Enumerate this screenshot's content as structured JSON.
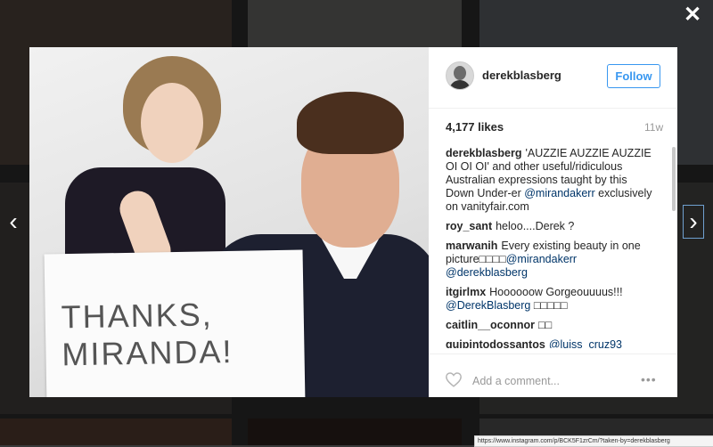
{
  "window": {
    "close_glyph": "✕",
    "prev_glyph": "‹",
    "next_glyph": "›",
    "status_url": "https://www.instagram.com/p/BCK5F1zrCm/?taken-by=derekblasberg"
  },
  "post": {
    "photo_sign_line1": "THANKS,",
    "photo_sign_line2": "MIRANDA!",
    "username": "derekblasberg",
    "follow_label": "Follow",
    "likes": "4,177 likes",
    "time_ago": "11w",
    "comments": [
      {
        "user": "derekblasberg",
        "text": "'AUZZIE AUZZIE AUZZIE OI OI OI' and other useful/ridiculous Australian expressions taught by this Down Under-er ",
        "mention": "@mirandakerr",
        "after": " exclusively on vanityfair.com"
      },
      {
        "user": "roy_sant",
        "text": "heloo....Derek ?",
        "mention": "",
        "after": ""
      },
      {
        "user": "marwanih",
        "text": "Every existing beauty in one picture□□□□",
        "mention": "@mirandakerr @derekblasberg",
        "after": ""
      },
      {
        "user": "itgirlmx",
        "text": "Hoooooow Gorgeouuuus!!! ",
        "mention": "@DerekBlasberg",
        "after": " □□□□□"
      },
      {
        "user": "caitlin__oconnor",
        "text": "□□",
        "mention": "",
        "after": ""
      },
      {
        "user": "guipintodossantos",
        "text": "",
        "mention": "@luiss_cruz93",
        "after": ""
      }
    ],
    "add_comment_placeholder": "Add a comment...",
    "more_glyph": "•••"
  },
  "colors": {
    "accent": "#3897f0",
    "mention": "#003569"
  }
}
